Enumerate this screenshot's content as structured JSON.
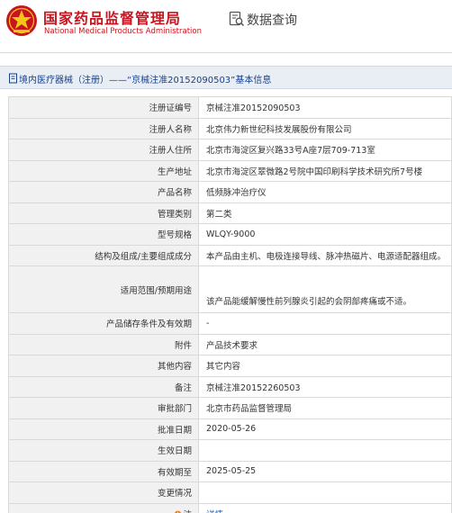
{
  "header": {
    "brand_cn": "国家药品监督管理局",
    "brand_en": "National Medical Products Administration",
    "query_label": "数据查询",
    "brand_color": "#c8141e"
  },
  "title_bar": {
    "text": "境内医疗器械（注册）——“京械注准20152090503”基本信息",
    "color": "#17408b"
  },
  "rows": [
    {
      "label": "注册证编号",
      "value": "京械注准20152090503"
    },
    {
      "label": "注册人名称",
      "value": "北京伟力新世纪科技发展股份有限公司"
    },
    {
      "label": "注册人住所",
      "value": "北京市海淀区复兴路33号A座7层709-713室"
    },
    {
      "label": "生产地址",
      "value": "北京市海淀区翠微路2号院中国印刷科学技术研究所7号楼"
    },
    {
      "label": "产品名称",
      "value": "低频脉冲治疗仪"
    },
    {
      "label": "管理类别",
      "value": "第二类"
    },
    {
      "label": "型号规格",
      "value": "WLQY-9000"
    },
    {
      "label": "结构及组成/主要组成成分",
      "value": "本产品由主机、电极连接导线、脉冲热磁片、电源适配器组成。"
    },
    {
      "label": "适用范围/预期用途",
      "value": "该产品能缓解慢性前列腺炎引起的会阴部疼痛或不适。"
    },
    {
      "label": "产品储存条件及有效期",
      "value": "-"
    },
    {
      "label": "附件",
      "value": "产品技术要求"
    },
    {
      "label": "其他内容",
      "value": "其它内容"
    },
    {
      "label": "备注",
      "value": "京械注准20152260503"
    },
    {
      "label": "审批部门",
      "value": "北京市药品监督管理局"
    },
    {
      "label": "批准日期",
      "value": "2020-05-26"
    },
    {
      "label": "生效日期",
      "value": ""
    },
    {
      "label": "有效期至",
      "value": "2025-05-25"
    },
    {
      "label": "变更情况",
      "value": ""
    },
    {
      "label": "注",
      "value": "详情",
      "icon": "note-icon"
    }
  ]
}
